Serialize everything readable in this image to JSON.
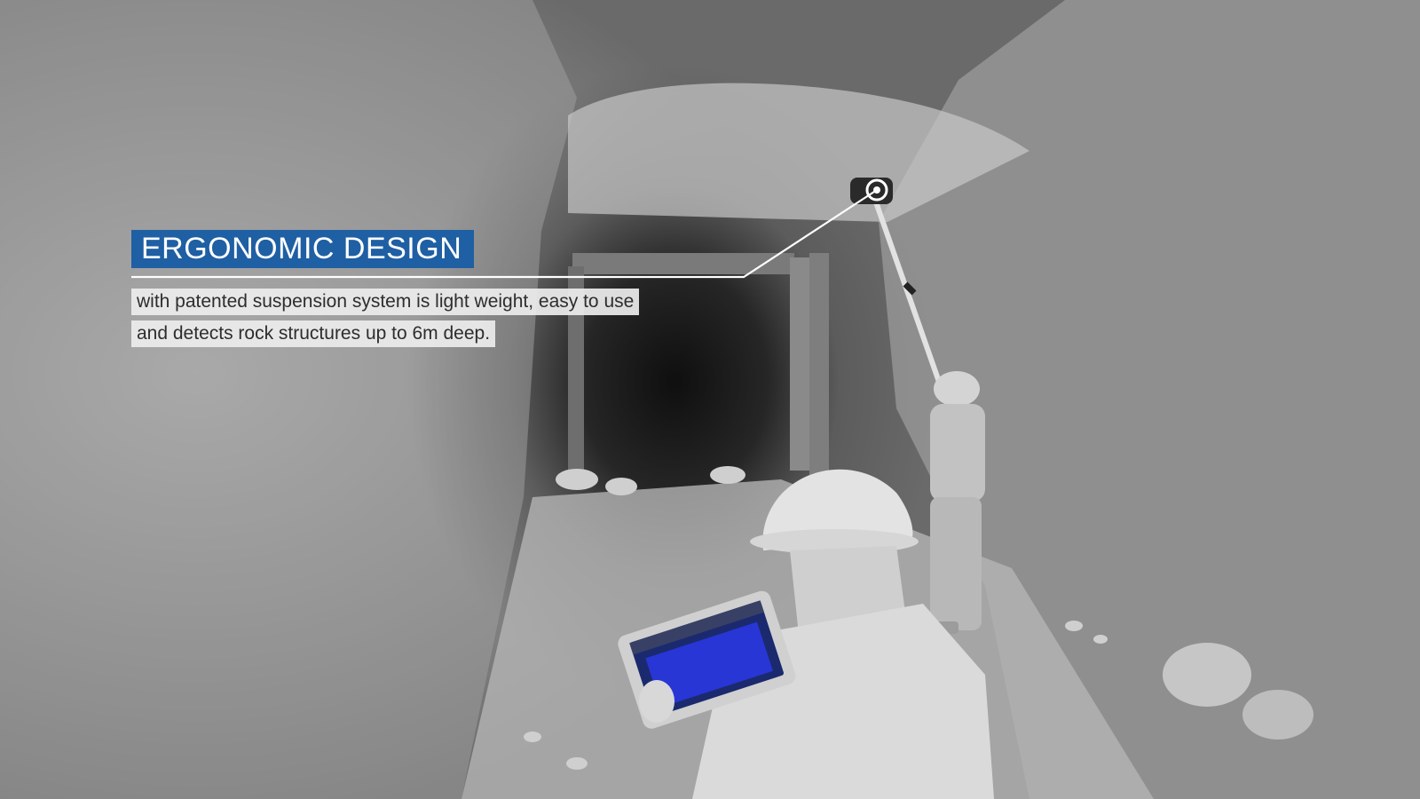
{
  "callout": {
    "title": "ERGONOMIC DESIGN",
    "description_line1": "with patented suspension system is light weight, easy to use",
    "description_line2": "and detects rock structures up to 6m deep."
  },
  "colors": {
    "title_background": "#1f5fa3",
    "title_text": "#ffffff",
    "description_background": "#ececec",
    "description_text": "#2d2d2d",
    "leader_line": "#ffffff"
  },
  "icons": [
    "target-marker-icon",
    "hard-hat-icon",
    "tablet-icon"
  ]
}
